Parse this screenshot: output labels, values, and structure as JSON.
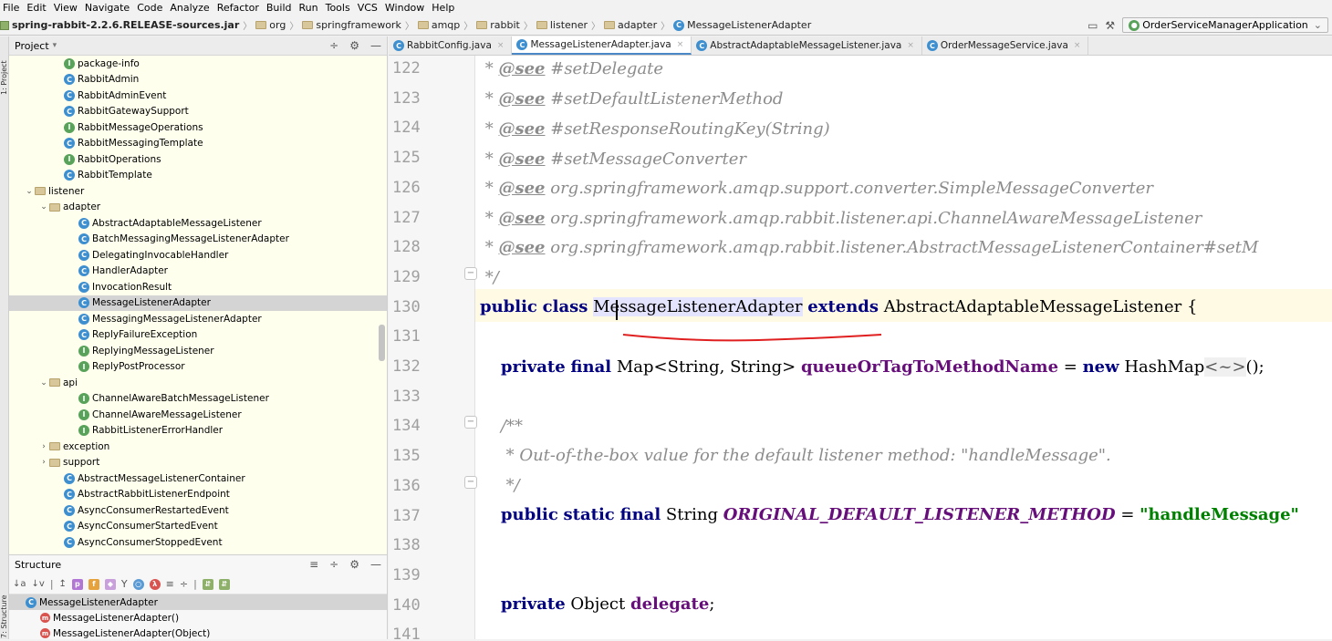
{
  "menu": [
    "File",
    "Edit",
    "View",
    "Navigate",
    "Code",
    "Analyze",
    "Refactor",
    "Build",
    "Run",
    "Tools",
    "VCS",
    "Window",
    "Help"
  ],
  "breadcrumb": [
    "spring-rabbit-2.2.6.RELEASE-sources.jar",
    "org",
    "springframework",
    "amqp",
    "rabbit",
    "listener",
    "adapter",
    "MessageListenerAdapter"
  ],
  "run_config": "OrderServiceManagerApplication",
  "side_tabs": {
    "project": "1: Project",
    "structure": "7: Structure"
  },
  "project_panel": {
    "title": "Project",
    "rows": [
      {
        "indent": 60,
        "icon": "iface",
        "label": "package-info"
      },
      {
        "indent": 60,
        "icon": "class",
        "label": "RabbitAdmin"
      },
      {
        "indent": 60,
        "icon": "class",
        "label": "RabbitAdminEvent"
      },
      {
        "indent": 60,
        "icon": "class",
        "label": "RabbitGatewaySupport"
      },
      {
        "indent": 60,
        "icon": "iface",
        "label": "RabbitMessageOperations"
      },
      {
        "indent": 60,
        "icon": "class",
        "label": "RabbitMessagingTemplate"
      },
      {
        "indent": 60,
        "icon": "iface",
        "label": "RabbitOperations"
      },
      {
        "indent": 60,
        "icon": "class",
        "label": "RabbitTemplate"
      },
      {
        "indent": 28,
        "icon": "folder",
        "arrow": "v",
        "label": "listener"
      },
      {
        "indent": 44,
        "icon": "folder",
        "arrow": "v",
        "label": "adapter"
      },
      {
        "indent": 76,
        "icon": "class",
        "label": "AbstractAdaptableMessageListener"
      },
      {
        "indent": 76,
        "icon": "class",
        "label": "BatchMessagingMessageListenerAdapter"
      },
      {
        "indent": 76,
        "icon": "class",
        "label": "DelegatingInvocableHandler"
      },
      {
        "indent": 76,
        "icon": "class",
        "label": "HandlerAdapter"
      },
      {
        "indent": 76,
        "icon": "class",
        "label": "InvocationResult"
      },
      {
        "indent": 76,
        "icon": "class",
        "label": "MessageListenerAdapter",
        "selected": true
      },
      {
        "indent": 76,
        "icon": "class",
        "label": "MessagingMessageListenerAdapter"
      },
      {
        "indent": 76,
        "icon": "class",
        "label": "ReplyFailureException"
      },
      {
        "indent": 76,
        "icon": "iface",
        "label": "ReplyingMessageListener"
      },
      {
        "indent": 76,
        "icon": "iface",
        "label": "ReplyPostProcessor"
      },
      {
        "indent": 44,
        "icon": "folder",
        "arrow": "v",
        "label": "api"
      },
      {
        "indent": 76,
        "icon": "iface",
        "label": "ChannelAwareBatchMessageListener"
      },
      {
        "indent": 76,
        "icon": "iface",
        "label": "ChannelAwareMessageListener"
      },
      {
        "indent": 76,
        "icon": "iface",
        "label": "RabbitListenerErrorHandler"
      },
      {
        "indent": 44,
        "icon": "folder",
        "arrow": ">",
        "label": "exception"
      },
      {
        "indent": 44,
        "icon": "folder",
        "arrow": ">",
        "label": "support"
      },
      {
        "indent": 60,
        "icon": "class",
        "label": "AbstractMessageListenerContainer"
      },
      {
        "indent": 60,
        "icon": "class",
        "label": "AbstractRabbitListenerEndpoint"
      },
      {
        "indent": 60,
        "icon": "class",
        "label": "AsyncConsumerRestartedEvent"
      },
      {
        "indent": 60,
        "icon": "class",
        "label": "AsyncConsumerStartedEvent"
      },
      {
        "indent": 60,
        "icon": "class",
        "label": "AsyncConsumerStoppedEvent"
      }
    ]
  },
  "structure_panel": {
    "title": "Structure",
    "rows": [
      {
        "indent": 18,
        "icon": "class",
        "label": "MessageListenerAdapter",
        "selected": true
      },
      {
        "indent": 34,
        "icon": "method",
        "label": "MessageListenerAdapter()"
      },
      {
        "indent": 34,
        "icon": "method",
        "label": "MessageListenerAdapter(Object)"
      }
    ]
  },
  "tabs": [
    {
      "label": "RabbitConfig.java",
      "active": false
    },
    {
      "label": "MessageListenerAdapter.java",
      "active": true
    },
    {
      "label": "AbstractAdaptableMessageListener.java",
      "active": false
    },
    {
      "label": "OrderMessageService.java",
      "active": false
    }
  ],
  "editor": {
    "line_numbers": [
      "122",
      "123",
      "124",
      "125",
      "126",
      "127",
      "128",
      "129",
      "130",
      "131",
      "132",
      "133",
      "134",
      "135",
      "136",
      "137",
      "138",
      "139",
      "140",
      "141"
    ],
    "code": {
      "l122": "#setDelegate",
      "l123": "#setDefaultListenerMethod",
      "l124": "#setResponseRoutingKey(String)",
      "l125": "#setMessageConverter",
      "l126": "org.springframework.amqp.support.converter.SimpleMessageConverter",
      "l127": "org.springframework.amqp.rabbit.listener.api.ChannelAwareMessageListener",
      "l128": "org.springframework.amqp.rabbit.listener.AbstractMessageListenerContainer#setM",
      "see": "@see",
      "kw_public": "public",
      "kw_class": "class",
      "class_name": "MessageListenerAdapter",
      "kw_extends": "extends",
      "super_name": "AbstractAdaptableMessageListener {",
      "kw_private": "private",
      "kw_final": "final",
      "map_type": "Map<String, String>",
      "map_field": "queueOrTagToMethodName",
      "kw_new": "new",
      "hashmap": "HashMap",
      "diamond": "<~>",
      "l132_end": "();",
      "l135": "* Out-of-the-box value for the default listener method: \"handleMessage\".",
      "kw_static": "static",
      "string_type": "String",
      "const_name": "ORIGINAL_DEFAULT_LISTENER_METHOD",
      "const_value": "\"handleMessage\"",
      "object_type": "Object",
      "delegate_field": "delegate"
    }
  }
}
